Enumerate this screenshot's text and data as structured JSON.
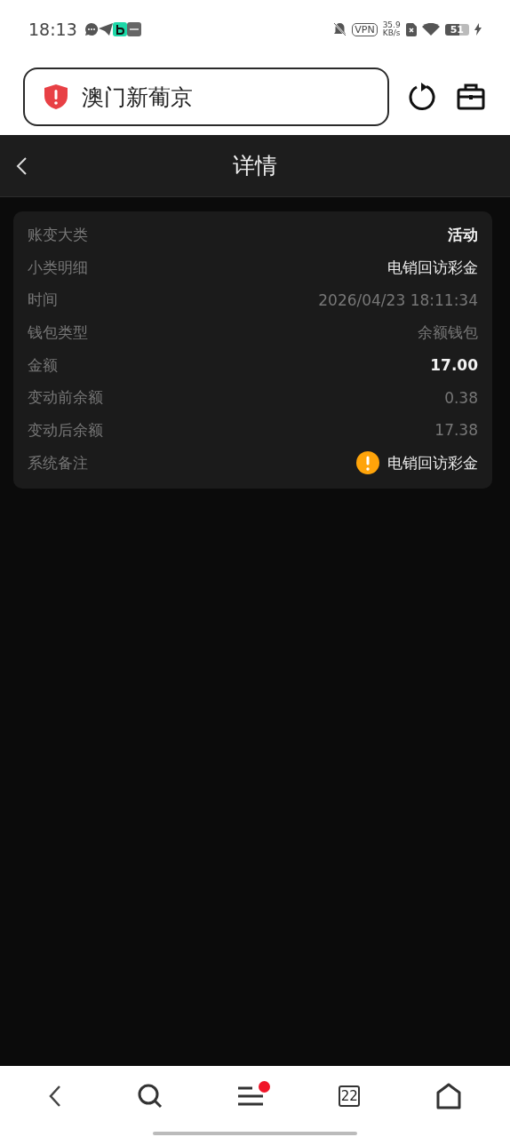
{
  "status_bar": {
    "time": "18:13",
    "vpn": "VPN",
    "speed_value": "35.9",
    "speed_unit": "KB/s",
    "battery": "51"
  },
  "browser_bar": {
    "address": "澳门新葡京"
  },
  "header": {
    "title": "详情"
  },
  "details": [
    {
      "label": "账变大类",
      "value": "活动",
      "kind": "strong"
    },
    {
      "label": "小类明细",
      "value": "电销回访彩金",
      "kind": "plain"
    },
    {
      "label": "时间",
      "value": "2026/04/23 18:11:34",
      "kind": "muted"
    },
    {
      "label": "钱包类型",
      "value": "余额钱包",
      "kind": "muted"
    },
    {
      "label": "金额",
      "value": "17.00",
      "kind": "strong"
    },
    {
      "label": "变动前余额",
      "value": "0.38",
      "kind": "muted"
    },
    {
      "label": "变动后余额",
      "value": "17.38",
      "kind": "muted"
    },
    {
      "label": "系统备注",
      "value": "电销回访彩金",
      "kind": "alert"
    }
  ],
  "bottom_nav": {
    "tab_count": "22",
    "menu_badge": true
  }
}
